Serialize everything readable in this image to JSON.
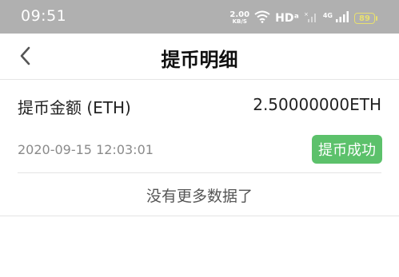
{
  "status_bar": {
    "time": "09:51",
    "speed_value": "2.00",
    "speed_unit": "KB/S",
    "wifi_icon": "wifi-icon",
    "hd_label": "HDᵃ",
    "network_label": "4G",
    "battery_level": "89",
    "colors": {
      "background": "#b0b0b0",
      "battery": "#e8e070"
    }
  },
  "nav": {
    "back_icon": "chevron-left-icon",
    "title": "提币明细"
  },
  "record": {
    "amount_label": "提币金额 (ETH)",
    "amount_value": "2.50000000ETH",
    "timestamp": "2020-09-15 12:03:01",
    "status": "提币成功",
    "status_color": "#5cc16b"
  },
  "list_footer": {
    "no_more_text": "没有更多数据了"
  }
}
